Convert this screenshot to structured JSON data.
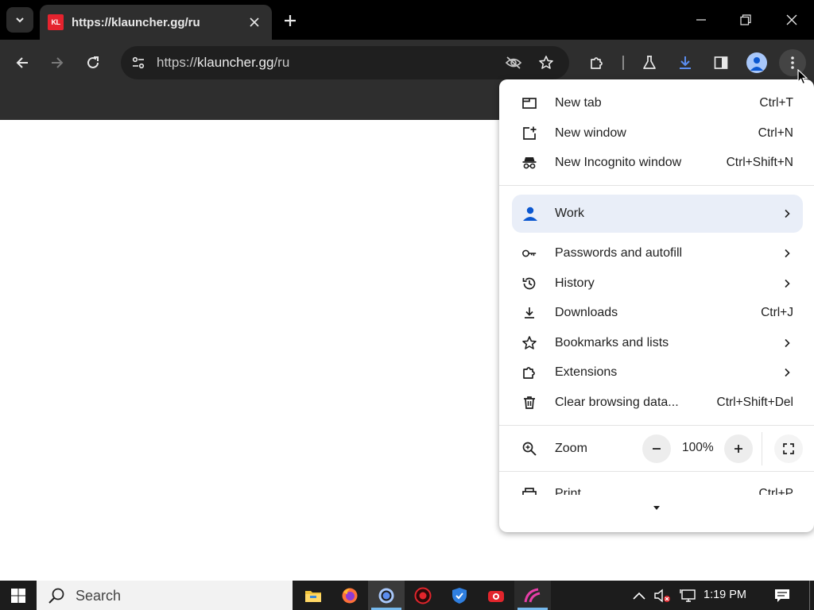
{
  "browser": {
    "tab": {
      "favicon_text": "KL",
      "title": "https://klauncher.gg/ru"
    },
    "omnibox": {
      "scheme": "https://",
      "host": "klauncher.gg",
      "path": "/ru"
    },
    "accent": "#a8c7fa",
    "download_color": "#5b8def"
  },
  "menu": {
    "top_items": [
      {
        "label": "New tab",
        "shortcut": "Ctrl+T",
        "icon": "new-tab-icon"
      },
      {
        "label": "New window",
        "shortcut": "Ctrl+N",
        "icon": "new-window-icon"
      },
      {
        "label": "New Incognito window",
        "shortcut": "Ctrl+Shift+N",
        "icon": "incognito-icon"
      }
    ],
    "profile": {
      "label": "Work",
      "icon": "person-icon"
    },
    "items": [
      {
        "label": "Passwords and autofill",
        "icon": "key-icon",
        "submenu": true
      },
      {
        "label": "History",
        "icon": "history-icon",
        "submenu": true
      },
      {
        "label": "Downloads",
        "shortcut": "Ctrl+J",
        "icon": "download-icon"
      },
      {
        "label": "Bookmarks and lists",
        "icon": "star-icon",
        "submenu": true
      },
      {
        "label": "Extensions",
        "icon": "puzzle-icon",
        "submenu": true
      },
      {
        "label": "Clear browsing data...",
        "shortcut": "Ctrl+Shift+Del",
        "icon": "trash-icon"
      }
    ],
    "zoom": {
      "label": "Zoom",
      "value": "100%",
      "minus": "−",
      "plus": "+"
    },
    "partial_item": {
      "label": "Print",
      "shortcut": "Ctrl+P"
    }
  },
  "taskbar": {
    "search_placeholder": "Search",
    "clock": "1:19 PM",
    "apps": [
      "file-explorer-icon",
      "firefox-icon",
      "chrome-icon",
      "app-red-icon",
      "shield-app-icon",
      "camera-app-icon",
      "launcher-app-icon"
    ]
  }
}
